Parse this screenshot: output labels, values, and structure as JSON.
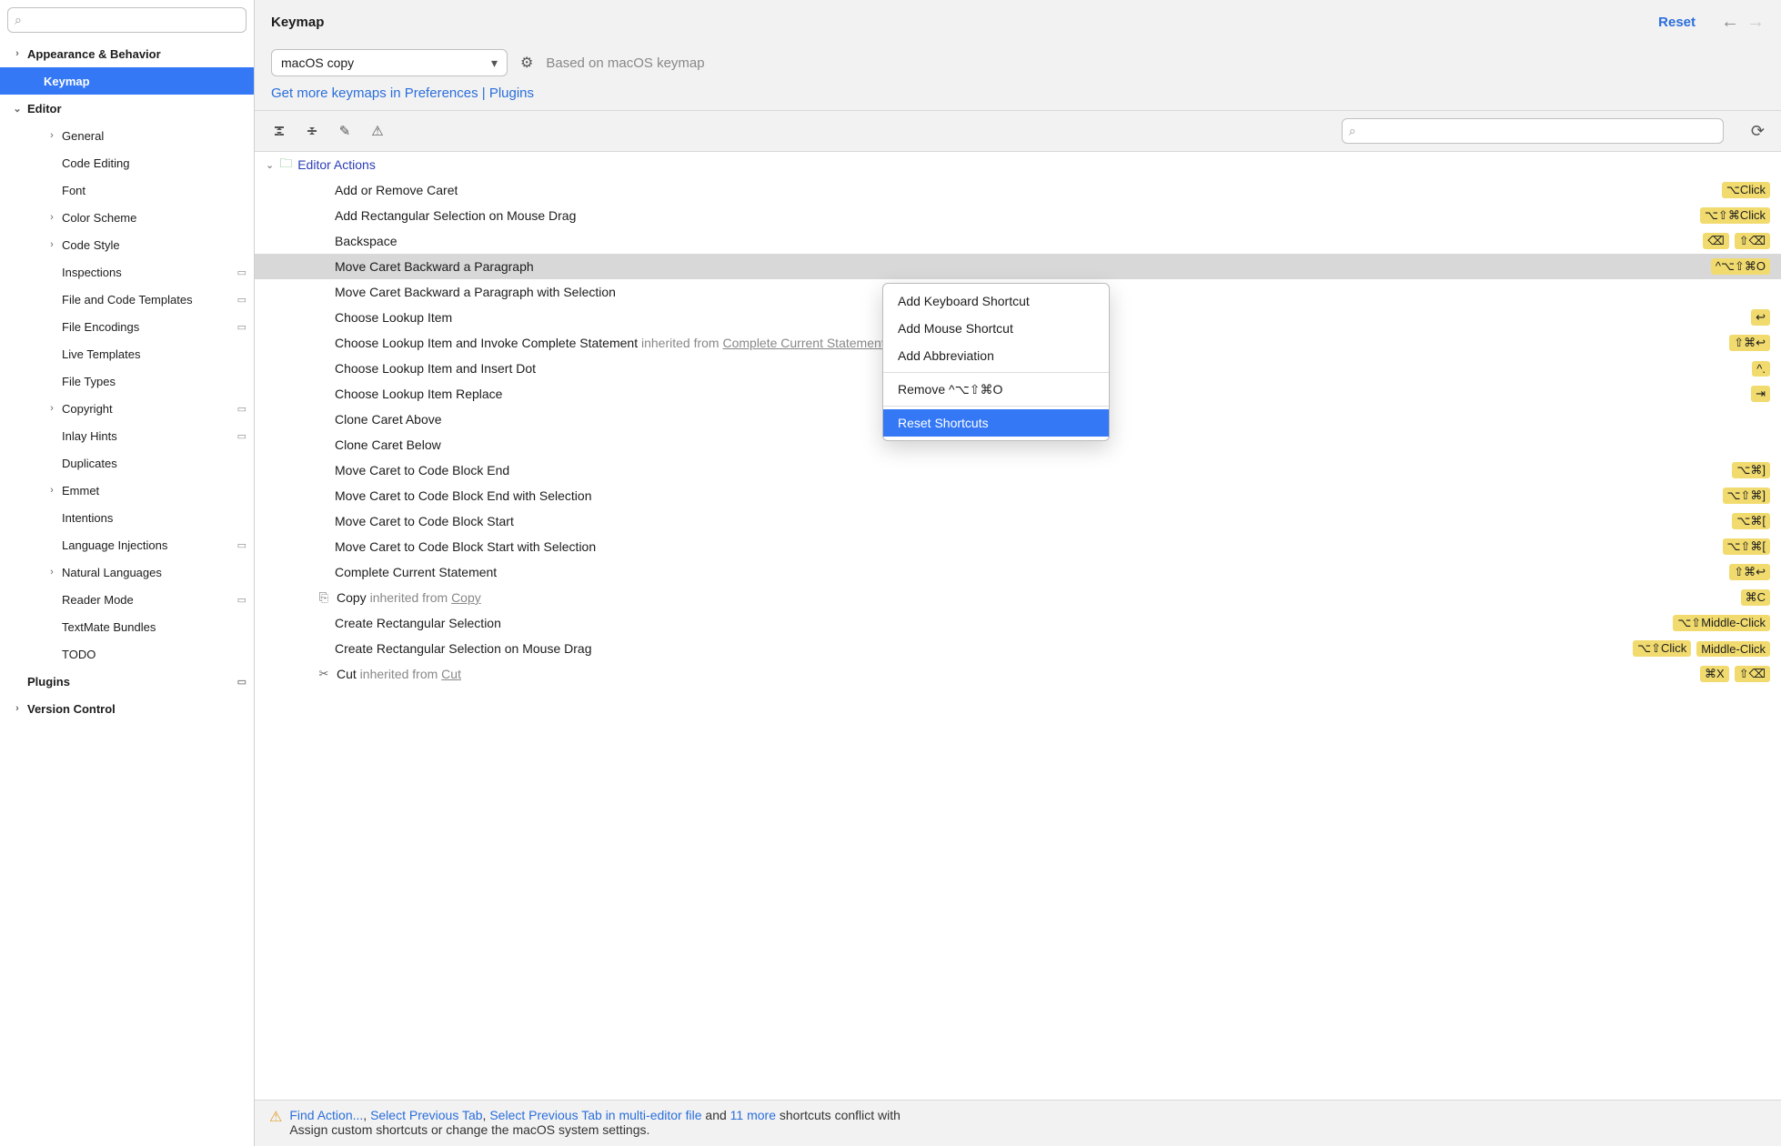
{
  "sidebar": {
    "search_placeholder": "",
    "items": [
      {
        "label": "Appearance & Behavior",
        "bold": true,
        "arrow": "›",
        "indent": 0
      },
      {
        "label": "Keymap",
        "bold": true,
        "selected": true,
        "indent": 1
      },
      {
        "label": "Editor",
        "bold": true,
        "arrow": "⌄",
        "indent": 0
      },
      {
        "label": "General",
        "arrow": "›",
        "indent": 2
      },
      {
        "label": "Code Editing",
        "indent": 2
      },
      {
        "label": "Font",
        "indent": 2
      },
      {
        "label": "Color Scheme",
        "arrow": "›",
        "indent": 2
      },
      {
        "label": "Code Style",
        "arrow": "›",
        "indent": 2
      },
      {
        "label": "Inspections",
        "indent": 2,
        "gear": true
      },
      {
        "label": "File and Code Templates",
        "indent": 2,
        "gear": true
      },
      {
        "label": "File Encodings",
        "indent": 2,
        "gear": true
      },
      {
        "label": "Live Templates",
        "indent": 2
      },
      {
        "label": "File Types",
        "indent": 2
      },
      {
        "label": "Copyright",
        "arrow": "›",
        "indent": 2,
        "gear": true
      },
      {
        "label": "Inlay Hints",
        "indent": 2,
        "gear": true
      },
      {
        "label": "Duplicates",
        "indent": 2
      },
      {
        "label": "Emmet",
        "arrow": "›",
        "indent": 2
      },
      {
        "label": "Intentions",
        "indent": 2
      },
      {
        "label": "Language Injections",
        "indent": 2,
        "gear": true
      },
      {
        "label": "Natural Languages",
        "arrow": "›",
        "indent": 2
      },
      {
        "label": "Reader Mode",
        "indent": 2,
        "gear": true
      },
      {
        "label": "TextMate Bundles",
        "indent": 2
      },
      {
        "label": "TODO",
        "indent": 2
      },
      {
        "label": "Plugins",
        "bold": true,
        "gear": true,
        "indent": 0
      },
      {
        "label": "Version Control",
        "bold": true,
        "arrow": "›",
        "indent": 0
      }
    ]
  },
  "header": {
    "title": "Keymap",
    "reset": "Reset"
  },
  "keymap": {
    "selected": "macOS copy",
    "based_on": "Based on macOS keymap",
    "more_link": "Get more keymaps in Preferences | Plugins"
  },
  "category": "Editor Actions",
  "actions": [
    {
      "label": "Add or Remove Caret",
      "shortcuts": [
        "⌥Click"
      ]
    },
    {
      "label": "Add Rectangular Selection on Mouse Drag",
      "shortcuts": [
        "⌥⇧⌘Click"
      ]
    },
    {
      "label": "Backspace",
      "shortcuts": [
        "⌫",
        "⇧⌫"
      ],
      "icon": true
    },
    {
      "label": "Move Caret Backward a Paragraph",
      "shortcuts": [
        "^⌥⇧⌘O"
      ],
      "selected": true
    },
    {
      "label": "Move Caret Backward a Paragraph with Selection"
    },
    {
      "label": "Choose Lookup Item",
      "shortcuts": [
        "↩"
      ],
      "icon": true
    },
    {
      "label": "Choose Lookup Item and Invoke Complete Statement",
      "inherited": "Complete Current Statement",
      "inh_pre": "inherited from",
      "shortcuts": [
        "⇧⌘↩"
      ],
      "icon": true
    },
    {
      "label": "Choose Lookup Item and Insert Dot",
      "shortcuts": [
        "^."
      ]
    },
    {
      "label": "Choose Lookup Item Replace",
      "shortcuts": [
        "⇥"
      ],
      "icon": true
    },
    {
      "label": "Clone Caret Above"
    },
    {
      "label": "Clone Caret Below"
    },
    {
      "label": "Move Caret to Code Block End",
      "shortcuts": [
        "⌥⌘]"
      ]
    },
    {
      "label": "Move Caret to Code Block End with Selection",
      "shortcuts": [
        "⌥⇧⌘]"
      ]
    },
    {
      "label": "Move Caret to Code Block Start",
      "shortcuts": [
        "⌥⌘["
      ]
    },
    {
      "label": "Move Caret to Code Block Start with Selection",
      "shortcuts": [
        "⌥⇧⌘["
      ]
    },
    {
      "label": "Complete Current Statement",
      "shortcuts": [
        "⇧⌘↩"
      ],
      "icon": true
    },
    {
      "label": "Copy",
      "row_icon": "⎘",
      "inherited": "Copy",
      "inh_pre": "inherited from",
      "shortcuts": [
        "⌘C"
      ]
    },
    {
      "label": "Create Rectangular Selection",
      "shortcuts": [
        "⌥⇧Middle-Click"
      ]
    },
    {
      "label": "Create Rectangular Selection on Mouse Drag",
      "shortcuts": [
        "⌥⇧Click",
        "Middle-Click"
      ]
    },
    {
      "label": "Cut",
      "row_icon": "✂",
      "inherited": "Cut",
      "inh_pre": "inherited from",
      "shortcuts": [
        "⌘X",
        "⇧⌫"
      ],
      "icon": true
    }
  ],
  "context_menu": {
    "items": [
      {
        "label": "Add Keyboard Shortcut"
      },
      {
        "label": "Add Mouse Shortcut"
      },
      {
        "label": "Add Abbreviation"
      },
      {
        "sep": true
      },
      {
        "label": "Remove ^⌥⇧⌘O"
      },
      {
        "sep": true
      },
      {
        "label": "Reset Shortcuts",
        "selected": true
      }
    ]
  },
  "footer": {
    "links": [
      "Find Action...",
      "Select Previous Tab",
      "Select Previous Tab in multi-editor file"
    ],
    "and": " and ",
    "more": "11 more",
    "tail": " shortcuts conflict with ",
    "line2": "Assign custom shortcuts or change the macOS system settings."
  }
}
